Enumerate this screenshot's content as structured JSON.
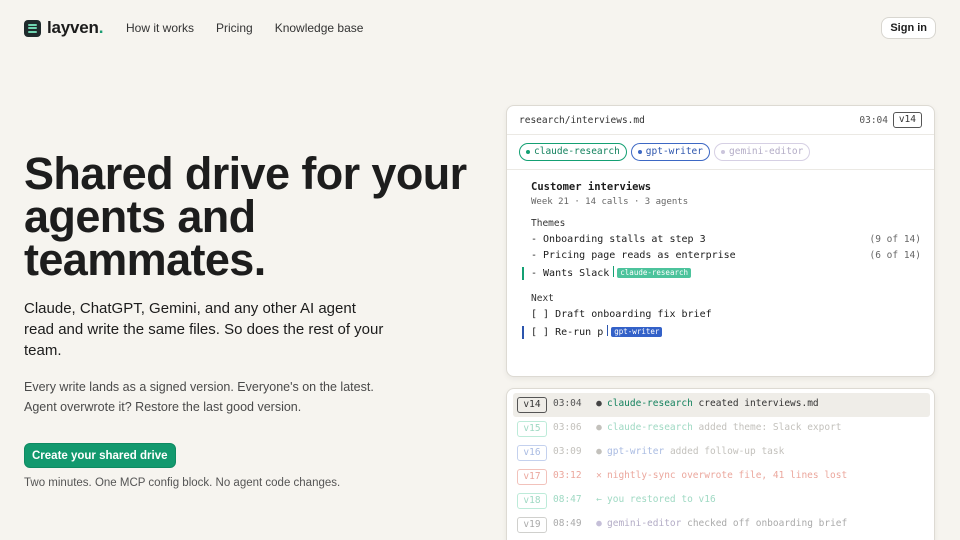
{
  "nav": {
    "logo": "layven",
    "logo_dot": ".",
    "links": [
      "How it works",
      "Pricing",
      "Knowledge base"
    ],
    "signin": "Sign in"
  },
  "hero": {
    "title": "Shared drive for your agents and teammates.",
    "subtitle": "Claude, ChatGPT, Gemini, and any other AI agent read and write the same files. So does the rest of your team.",
    "note_line1": "Every write lands as a signed version. Everyone's on the latest.",
    "note_line2": "Agent overwrote it? Restore the last good version.",
    "cta": "Create your shared drive",
    "cta_note": "Two minutes. One MCP config block. No agent code changes."
  },
  "editor": {
    "path": "research/interviews.md",
    "time": "03:04",
    "version": "v14",
    "chips": [
      "claude-research",
      "gpt-writer",
      "gemini-editor"
    ],
    "doc_title": "Customer interviews",
    "doc_meta": "Week 21 · 14 calls · 3 agents",
    "themes_heading": "Themes",
    "themes": [
      {
        "text": "- Onboarding stalls at step 3",
        "count": "(9 of 14)"
      },
      {
        "text": "- Pricing page reads as enterprise",
        "count": "(6 of 14)"
      },
      {
        "text": "- Wants Slack",
        "tag": "claude-research"
      }
    ],
    "next_heading": "Next",
    "tasks": [
      {
        "text": "[ ] Draft onboarding fix brief"
      },
      {
        "text": "[ ] Re-run p",
        "tag": "gpt-writer"
      }
    ],
    "colors": {
      "green": "#14a073",
      "blue": "#2c55ad"
    }
  },
  "history": [
    {
      "version": "v14",
      "time": "03:04",
      "symbol": "●",
      "agent": "claude-research",
      "action": "created interviews.md",
      "state": "active"
    },
    {
      "version": "v15",
      "time": "03:06",
      "symbol": "●",
      "agent": "claude-research",
      "action": "added theme: Slack export",
      "state": "pending-green"
    },
    {
      "version": "v16",
      "time": "03:09",
      "symbol": "●",
      "agent": "gpt-writer",
      "action": "added follow-up task",
      "state": "pending-blue"
    },
    {
      "version": "v17",
      "time": "03:12",
      "symbol": "✕",
      "agent": "",
      "action": "nightly-sync overwrote file, 41 lines lost",
      "state": "pending-red"
    },
    {
      "version": "v18",
      "time": "08:47",
      "symbol": "←",
      "agent": "",
      "action": "you restored to v16",
      "state": "pending-green"
    },
    {
      "version": "v19",
      "time": "08:49",
      "symbol": "●",
      "agent": "gemini-editor",
      "action": "checked off onboarding brief",
      "state": "pending-purple"
    }
  ]
}
